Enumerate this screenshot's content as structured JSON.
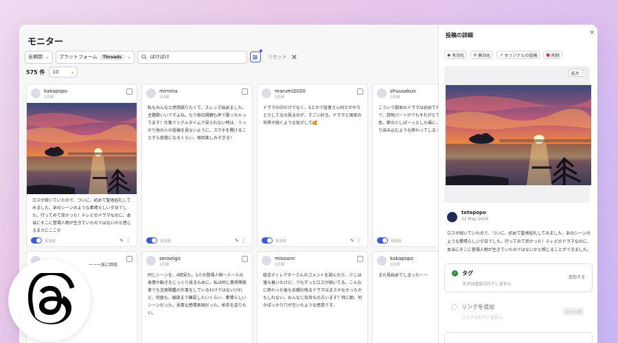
{
  "page": {
    "title": "モニター"
  },
  "filters": {
    "period": "全期間",
    "platform_label": "プラットフォーム",
    "platform_tag": "Threads",
    "search_value": "ばけばけ",
    "reset_label": "リセット"
  },
  "results": {
    "count": "575 件",
    "per_page": "10"
  },
  "cards": [
    {
      "user": "kakapopo",
      "time": "1日前",
      "text": "ロスが続いていたので、ついに、初めて聖地巡礼してみました。あのシーンのような素晴らしい夕日でした。行ってみて良かった！テレビのドラマなのに、本当にそこに登場人物が生きていたのではないかと感じるまさにここだ",
      "toggle_label": "有効化"
    },
    {
      "user": "minnna",
      "time": "1日前",
      "text": "私もみんなと感想語りたくて、スレッズ始めました。主題歌いいですよね。もう毎日視聴も声で歌っちゃってます！仕事でリアルタイムで見られない時は、うっかり他の人の投稿を見ないように、スマホを開けることすら我慢になるくらい、毎回楽しみすぎる！",
      "toggle_label": "有効化"
    },
    {
      "user": "marumi2020",
      "time": "1日前",
      "text": "ドラマの中だけでなく、Xとかで役者さん同士がやりとりしてるの見るのが、すごい好き。ドラマと現実の世界が続くような気がして🥰",
      "toggle_label": "有効化"
    },
    {
      "user": "shuusakun",
      "time": "1日前",
      "text": "こういう脚本のドラマは初めてだ…視聴者を委ねる形で、説明パートがでもそれがとても心地よかった。色、節の少しぼーっとした描に、まるような、じんわり染み込むような終わってしまってとても寂しい。",
      "toggle_label": "有効化"
    },
    {
      "user": "",
      "time": "",
      "text": "ーー一気に回収"
    },
    {
      "user": "senseigo",
      "time": "1日前",
      "text": "同じシーンを、4回見た。3人の登場人物一人一人の表情や動きをじっくり見るために。私は同じ業界関係者でも芝居開鑑の仕事をしているわけではないけれど、何度も、細部まで確認したいくらい、素晴らしいシーンだった。見事な感情表現だった。拍手を送りたい。"
    },
    {
      "user": "misoann",
      "time": "1日前",
      "text": "総合ディレクターさんのコメントを読んだら、少しは落ち着いたけど、でもずっとロスが続いてる。こんなに終わった後も余韻の残るドラマはまさかなかったかもしれない。おんなじ気持ちの方います？特に朝、何かぽっかり穴が空いたような感覚です。"
    },
    {
      "user": "kakapopo",
      "time": "1日前",
      "text": "また見始めてしまったーー"
    }
  ],
  "panel": {
    "title": "投稿の詳細",
    "actions": [
      "有効化",
      "無効化",
      "オリジナルの投稿",
      "削除"
    ],
    "expand_label": "拡大",
    "author": "tetepopo",
    "date": "22 May 2026",
    "text": "ロスが続いていたので、ついに、初めて聖地巡礼してみました。あのシーンのような素晴らしい夕日でした。行ってみて良かった！テレビのドラマなのに、本当にそこに登場人物が生きていたのではないかと感じることができました。",
    "tag": {
      "title": "タグ",
      "subtitle": "タグは追加されていません",
      "add": "追加する"
    },
    "link": {
      "title": "リンクを追加",
      "subtitle": "リンクされていません",
      "add": "自己公開"
    }
  },
  "colors": {
    "accent": "#3b5bdb",
    "delete": "#e03131",
    "tag_check": "#2b8a3e"
  },
  "icons": [
    "chevron-down-icon",
    "search-icon",
    "filter-icon",
    "close-icon",
    "edit-icon",
    "more-icon",
    "eye-icon",
    "eye-off-icon",
    "external-link-icon",
    "trash-icon",
    "expand-icon",
    "check-icon",
    "threads-logo-icon"
  ]
}
